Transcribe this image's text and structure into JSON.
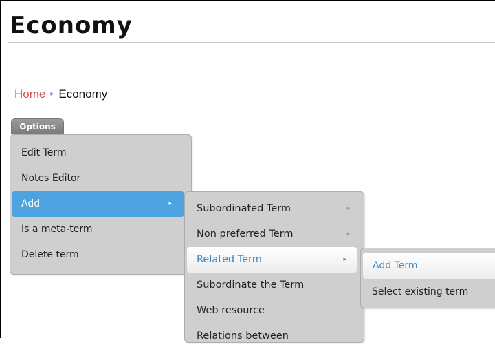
{
  "page": {
    "title": "Economy"
  },
  "breadcrumb": {
    "home": "Home",
    "separator": "▸",
    "current": "Economy"
  },
  "options": {
    "tab_label": "Options",
    "menu": [
      {
        "label": "Edit Term",
        "arrow": ""
      },
      {
        "label": "Notes Editor",
        "arrow": ""
      },
      {
        "label": "Add",
        "arrow": "▸"
      },
      {
        "label": "Is a meta-term",
        "arrow": ""
      },
      {
        "label": "Delete term",
        "arrow": ""
      }
    ]
  },
  "add_submenu": [
    {
      "label": "Subordinated Term",
      "arrow": "▸"
    },
    {
      "label": "Non preferred Term",
      "arrow": "▸"
    },
    {
      "label": "Related Term",
      "arrow": "▸"
    },
    {
      "label": "Subordinate the Term",
      "arrow": ""
    },
    {
      "label": "Web resource",
      "arrow": ""
    },
    {
      "label": "Relations between",
      "arrow": ""
    }
  ],
  "related_submenu": [
    {
      "label": "Add Term"
    },
    {
      "label": "Select existing term"
    }
  ],
  "colors": {
    "link": "#d9534f",
    "accent": "#3a86c8",
    "highlight": "#4da3e0",
    "menu_bg": "#cfcfcf"
  }
}
